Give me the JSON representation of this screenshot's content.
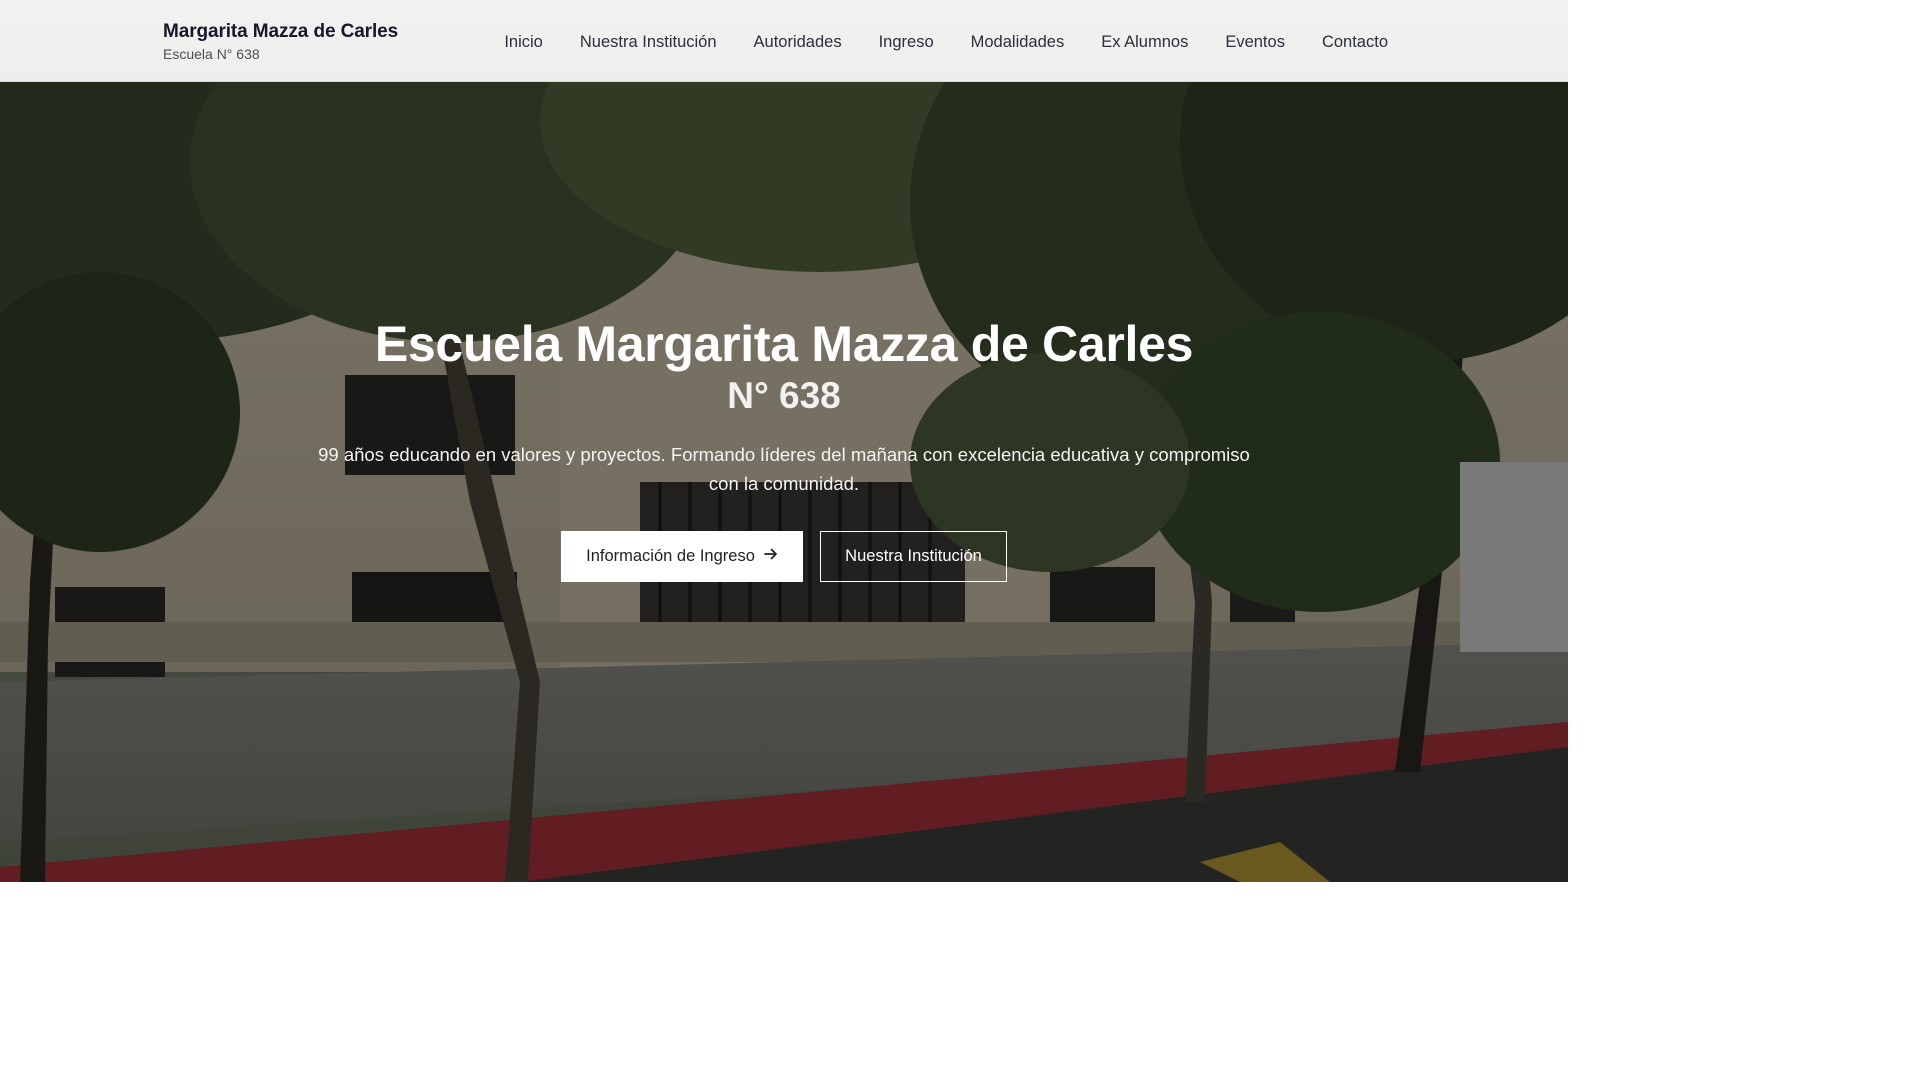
{
  "header": {
    "brand_name": "Margarita Mazza de Carles",
    "brand_sub": "Escuela N° 638",
    "nav": [
      {
        "label": "Inicio"
      },
      {
        "label": "Nuestra Institución"
      },
      {
        "label": "Autoridades"
      },
      {
        "label": "Ingreso"
      },
      {
        "label": "Modalidades"
      },
      {
        "label": "Ex Alumnos"
      },
      {
        "label": "Eventos"
      },
      {
        "label": "Contacto"
      }
    ]
  },
  "hero": {
    "title": "Escuela Margarita Mazza de Carles",
    "number": "N° 638",
    "description": "99 años educando en valores y proyectos. Formando líderes del mañana con excelencia educativa y compromiso con la comunidad.",
    "primary_button": "Información de Ingreso",
    "primary_button_icon": "arrow-right-icon",
    "secondary_button": "Nuestra Institución"
  },
  "colors": {
    "header_bg": "#f2f2f0",
    "brand_text": "#15172b",
    "hero_text": "#ffffff",
    "primary_button_bg": "#ffffff",
    "curb_red": "#a8323a"
  }
}
